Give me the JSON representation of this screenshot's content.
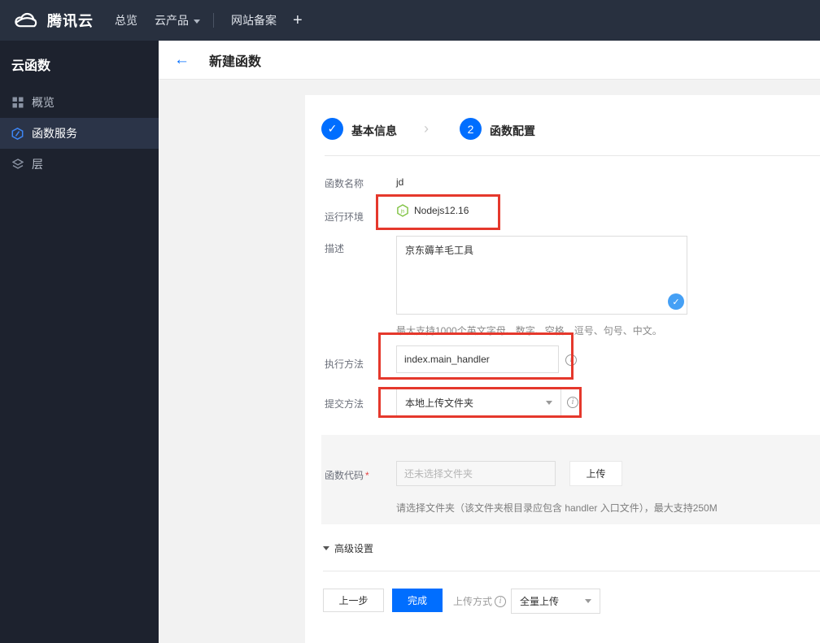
{
  "topnav": {
    "brand": "腾讯云",
    "overview": "总览",
    "products": "云产品",
    "icp": "网站备案",
    "plus": "+"
  },
  "sidebar": {
    "title": "云函数",
    "items": [
      {
        "label": "概览"
      },
      {
        "label": "函数服务"
      },
      {
        "label": "层"
      }
    ]
  },
  "header": {
    "title": "新建函数"
  },
  "steps": {
    "step1_label": "基本信息",
    "step1_check": "✓",
    "separator": "›",
    "step2_number": "2",
    "step2_label": "函数配置"
  },
  "form": {
    "name_label": "函数名称",
    "name_value": "jd",
    "runtime_label": "运行环境",
    "runtime_value": "Nodejs12.16",
    "desc_label": "描述",
    "desc_value": "京东薅羊毛工具",
    "desc_valid_check": "✓",
    "desc_hint": "最大支持1000个英文字母、数字、空格、逗号、句号、中文。",
    "handler_label": "执行方法",
    "handler_value": "index.main_handler",
    "submit_label": "提交方法",
    "submit_value": "本地上传文件夹",
    "code_label": "函数代码",
    "required_mark": "*",
    "code_placeholder": "还未选择文件夹",
    "upload_button": "上传",
    "code_hint": "请选择文件夹（该文件夹根目录应包含 handler 入口文件），最大支持250M",
    "advanced_label": "高级设置"
  },
  "footer": {
    "prev_button": "上一步",
    "done_button": "完成",
    "upload_mode_label": "上传方式",
    "upload_mode_value": "全量上传"
  },
  "colors": {
    "accent_blue": "#006eff",
    "light_check_blue": "#45a0f5",
    "annotation_red": "#e5382c",
    "node_green": "#7fc241",
    "nav_bg": "#28303f",
    "sidebar_bg": "#1d222e"
  }
}
